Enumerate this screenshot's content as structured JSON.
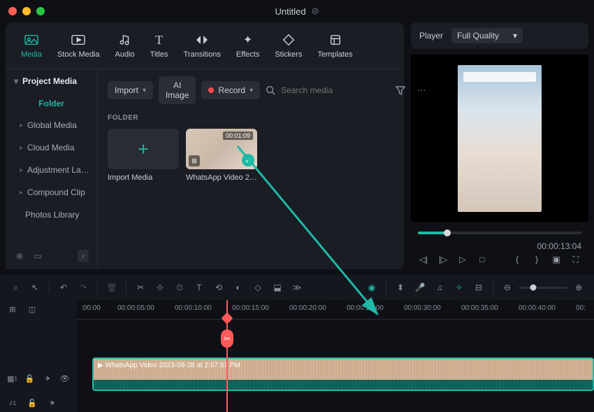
{
  "window": {
    "title": "Untitled"
  },
  "tabs": [
    {
      "label": "Media",
      "active": true
    },
    {
      "label": "Stock Media"
    },
    {
      "label": "Audio"
    },
    {
      "label": "Titles"
    },
    {
      "label": "Transitions"
    },
    {
      "label": "Effects"
    },
    {
      "label": "Stickers"
    },
    {
      "label": "Templates"
    }
  ],
  "sidebar": {
    "head": "Project Media",
    "folder": "Folder",
    "items": [
      {
        "label": "Global Media"
      },
      {
        "label": "Cloud Media"
      },
      {
        "label": "Adjustment La…"
      },
      {
        "label": "Compound Clip"
      },
      {
        "label": "Photos Library"
      }
    ]
  },
  "toolbar": {
    "import": "Import",
    "ai_image": "AI Image",
    "record": "Record",
    "search_placeholder": "Search media"
  },
  "section": "FOLDER",
  "cards": {
    "import": "Import Media",
    "video": {
      "label": "WhatsApp Video 202…",
      "duration": "00:01:09"
    }
  },
  "player": {
    "title": "Player",
    "quality": "Full Quality",
    "time": "00:00:13:04"
  },
  "timeline": {
    "ticks": [
      ":00:00",
      "00:00:05:00",
      "00:00:10:00",
      "00:00:15:00",
      "00:00:20:00",
      "00:00:25:00",
      "00:00:30:00",
      "00:00:35:00",
      "00:00:40:00",
      "00:"
    ],
    "clip_label": "WhatsApp Video 2023-09-28 at 2:07:57 PM",
    "playhead_pct": 29
  }
}
